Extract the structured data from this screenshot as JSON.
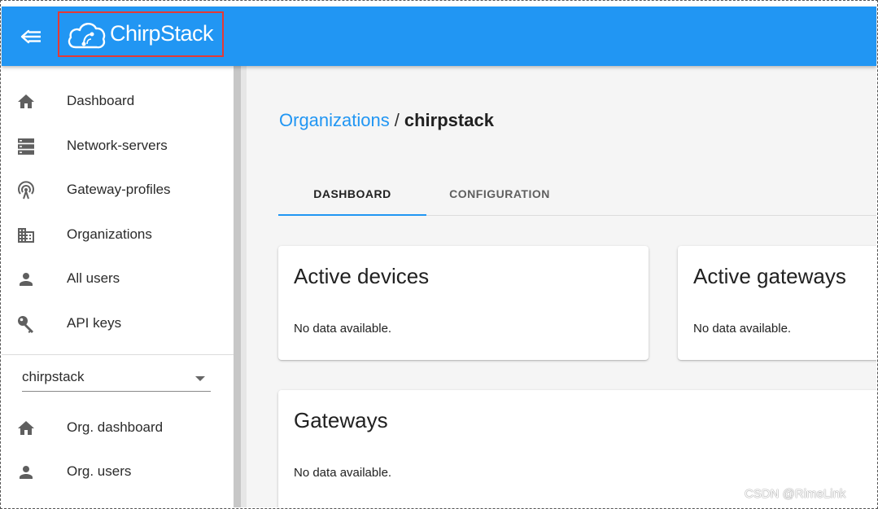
{
  "header": {
    "brand_name": "ChirpStack",
    "menu_icon": "menu-collapse-icon",
    "brand_color": "#2196f3"
  },
  "sidebar": {
    "items": [
      {
        "label": "Dashboard",
        "icon": "home-icon"
      },
      {
        "label": "Network-servers",
        "icon": "server-icon"
      },
      {
        "label": "Gateway-profiles",
        "icon": "antenna-icon"
      },
      {
        "label": "Organizations",
        "icon": "building-icon"
      },
      {
        "label": "All users",
        "icon": "person-icon"
      },
      {
        "label": "API keys",
        "icon": "key-icon"
      }
    ],
    "org_select": {
      "value": "chirpstack"
    },
    "org_items": [
      {
        "label": "Org. dashboard",
        "icon": "home-icon"
      },
      {
        "label": "Org. users",
        "icon": "person-icon"
      }
    ]
  },
  "main": {
    "breadcrumb": {
      "parent": "Organizations",
      "separator": "/",
      "current": "chirpstack"
    },
    "tabs": [
      {
        "label": "DASHBOARD",
        "active": true
      },
      {
        "label": "CONFIGURATION",
        "active": false
      }
    ],
    "cards": [
      {
        "title": "Active devices",
        "message": "No data available."
      },
      {
        "title": "Active gateways",
        "message": "No data available."
      },
      {
        "title": "Gateways",
        "message": "No data available."
      }
    ]
  },
  "watermark": "CSDN @RimeLink"
}
